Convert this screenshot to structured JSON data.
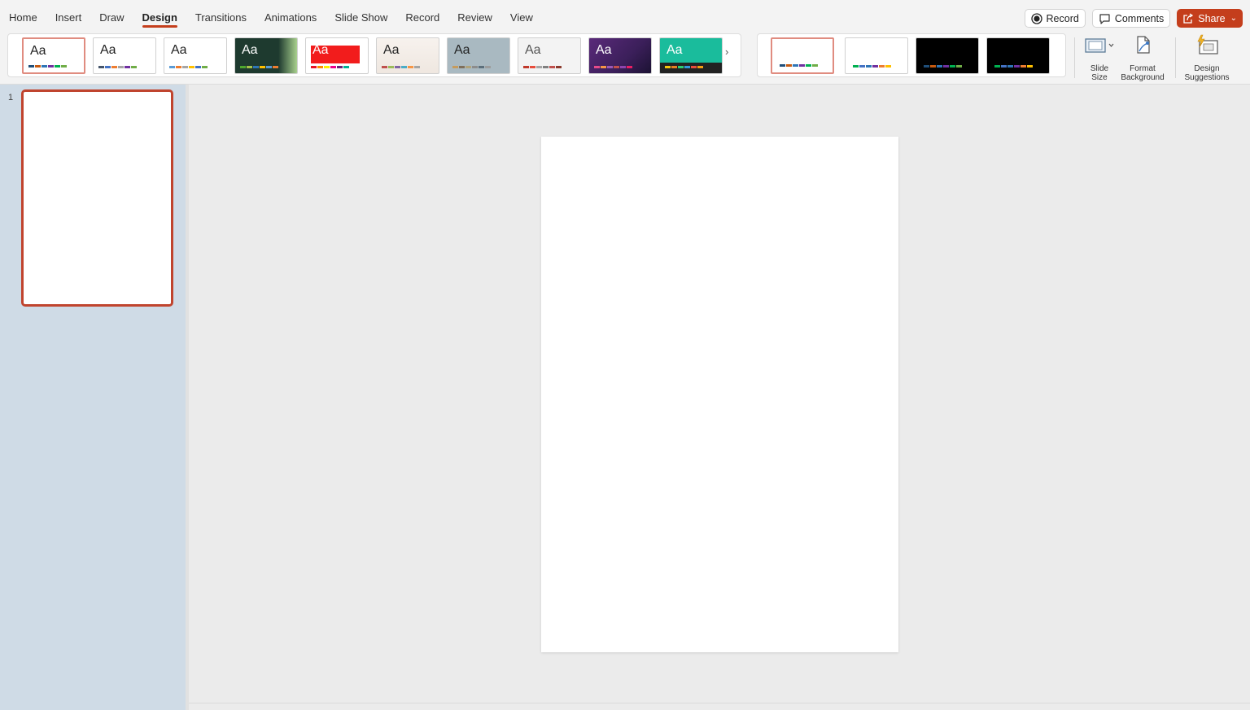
{
  "tabs": [
    "Home",
    "Insert",
    "Draw",
    "Design",
    "Transitions",
    "Animations",
    "Slide Show",
    "Record",
    "Review",
    "View"
  ],
  "active_tab": "Design",
  "actions": {
    "record_label": "Record",
    "comments_label": "Comments",
    "share_label": "Share"
  },
  "themes": [
    {
      "name": "office-theme",
      "aa": "Aa",
      "bg": "#ffffff",
      "fg": "#222222",
      "colors": [
        "#1f4e79",
        "#c55a11",
        "#2e75b6",
        "#7030a0",
        "#00b050",
        "#70ad47"
      ]
    },
    {
      "name": "office-theme-2",
      "aa": "Aa",
      "bg": "#ffffff",
      "fg": "#222222",
      "colors": [
        "#44546a",
        "#4472c4",
        "#ed7d31",
        "#a5a5a5",
        "#7030a0",
        "#70ad47"
      ]
    },
    {
      "name": "office-theme-3",
      "aa": "Aa",
      "bg": "#ffffff",
      "fg": "#222222",
      "colors": [
        "#5b9bd5",
        "#ed7d31",
        "#a5a5a5",
        "#ffc000",
        "#4472c4",
        "#70ad47"
      ]
    },
    {
      "name": "green-theme",
      "aa": "Aa",
      "bg": "#1e3a2f",
      "fg": "#ffffff",
      "colors": [
        "#4ea72e",
        "#a5c249",
        "#2e75b6",
        "#ffc000",
        "#5b9bd5",
        "#ed7d31"
      ]
    },
    {
      "name": "red-theme",
      "aa": "Aa",
      "bg": "#ffffff",
      "fg": "#ffffff",
      "colors": [
        "#e81123",
        "#ff8c00",
        "#fff100",
        "#ec008c",
        "#68217a",
        "#00b294"
      ]
    },
    {
      "name": "gradient-theme",
      "aa": "Aa",
      "bg": "#efe7e0",
      "fg": "#222222",
      "colors": [
        "#c0504d",
        "#9bbb59",
        "#8064a2",
        "#4bacc6",
        "#f79646",
        "#a5a5a5"
      ]
    },
    {
      "name": "slate-theme",
      "aa": "Aa",
      "bg": "#a9b9c1",
      "fg": "#222222",
      "colors": [
        "#c69b5d",
        "#7f6f5b",
        "#b0a37b",
        "#8c8c8c",
        "#5c6f7b",
        "#9c9c9c"
      ]
    },
    {
      "name": "dotted-theme",
      "aa": "Aa",
      "bg": "#f3f3f3",
      "fg": "#555555",
      "colors": [
        "#c0392b",
        "#e74c3c",
        "#a5a5a5",
        "#7f7f7f",
        "#c0504d",
        "#8c3b2e"
      ]
    },
    {
      "name": "purple-theme",
      "aa": "Aa",
      "bg": "#3b1f5a",
      "fg": "#ffffff",
      "colors": [
        "#e64b8a",
        "#f79646",
        "#9b59b6",
        "#c0504d",
        "#8e44ad",
        "#e91e63"
      ]
    },
    {
      "name": "teal-theme",
      "aa": "Aa",
      "bg": "#1abc9c",
      "fg": "#ffffff",
      "colors": [
        "#f1c40f",
        "#e67e22",
        "#2ecc71",
        "#3498db",
        "#e74c3c",
        "#f39c12"
      ]
    }
  ],
  "variants": [
    {
      "name": "variant-white-1",
      "bg": "#ffffff",
      "colors": [
        "#1f4e79",
        "#c55a11",
        "#2e75b6",
        "#7030a0",
        "#00b050",
        "#70ad47"
      ]
    },
    {
      "name": "variant-white-2",
      "bg": "#ffffff",
      "colors": [
        "#00b050",
        "#4472c4",
        "#2e75b6",
        "#7030a0",
        "#ed7d31",
        "#ffc000"
      ]
    },
    {
      "name": "variant-black-1",
      "bg": "#000000",
      "colors": [
        "#1f4e79",
        "#c55a11",
        "#2e75b6",
        "#7030a0",
        "#00b050",
        "#70ad47"
      ]
    },
    {
      "name": "variant-black-2",
      "bg": "#000000",
      "colors": [
        "#00b050",
        "#4472c4",
        "#2e75b6",
        "#7030a0",
        "#ed7d31",
        "#ffc000"
      ]
    }
  ],
  "customize": {
    "slide_size_label": "Slide\nSize",
    "format_background_label": "Format\nBackground",
    "design_suggestions_label": "Design\nSuggestions"
  },
  "slides": [
    {
      "number": "1"
    }
  ],
  "colors": {
    "accent": "#c43e1c",
    "pane": "#cfdbe6"
  }
}
